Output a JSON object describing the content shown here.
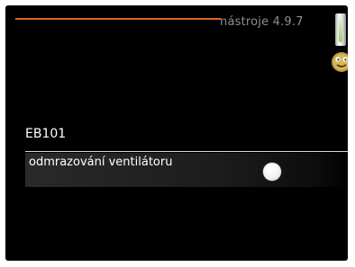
{
  "header": {
    "menu_number": "nástroje 4.9.7",
    "accent_color": "#d8672a"
  },
  "status_icons": {
    "thermometer": "thermometer-icon",
    "smiley": "smiley-face-icon"
  },
  "menu": {
    "label": "EB101",
    "option_label": "odmrazování ventilátoru",
    "toggle_state": "off"
  }
}
